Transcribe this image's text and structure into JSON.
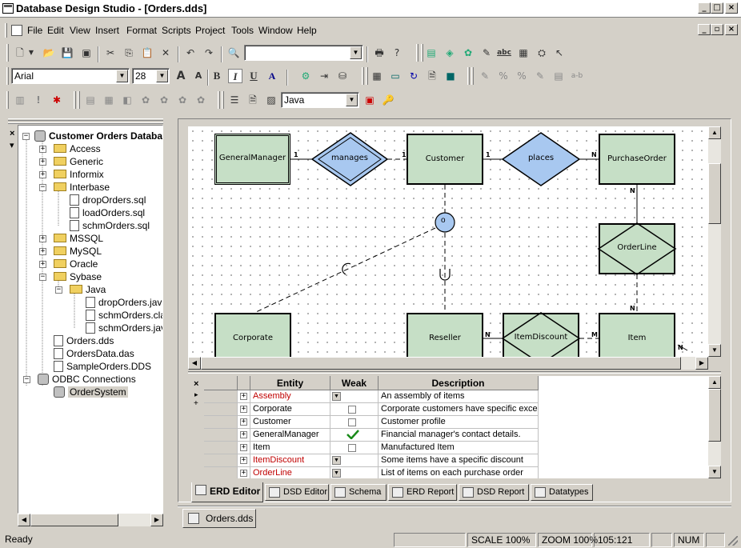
{
  "window": {
    "title": "Database Design Studio - [Orders.dds]",
    "min": "_",
    "max": "□",
    "close": "×",
    "restore": "▫"
  },
  "menu": [
    "File",
    "Edit",
    "View",
    "Insert",
    "Format",
    "Scripts",
    "Project",
    "Tools",
    "Window",
    "Help"
  ],
  "toolbar": {
    "font": "Arial",
    "size": "28",
    "bold": "B",
    "italic": "I",
    "underline": "U",
    "language": "Java",
    "abc": "abc",
    "ab": "a-b"
  },
  "tree": {
    "root": "Customer Orders Databa",
    "items": [
      {
        "label": "Access",
        "level": 1,
        "kind": "folder",
        "exp": "+"
      },
      {
        "label": "Generic",
        "level": 1,
        "kind": "folder",
        "exp": "+"
      },
      {
        "label": "Informix",
        "level": 1,
        "kind": "folder",
        "exp": "+"
      },
      {
        "label": "Interbase",
        "level": 1,
        "kind": "folder",
        "exp": "−"
      },
      {
        "label": "dropOrders.sql",
        "level": 2,
        "kind": "file"
      },
      {
        "label": "loadOrders.sql",
        "level": 2,
        "kind": "file"
      },
      {
        "label": "schmOrders.sql",
        "level": 2,
        "kind": "file"
      },
      {
        "label": "MSSQL",
        "level": 1,
        "kind": "folder",
        "exp": "+"
      },
      {
        "label": "MySQL",
        "level": 1,
        "kind": "folder",
        "exp": "+"
      },
      {
        "label": "Oracle",
        "level": 1,
        "kind": "folder",
        "exp": "+"
      },
      {
        "label": "Sybase",
        "level": 1,
        "kind": "folder",
        "exp": "−"
      },
      {
        "label": "Java",
        "level": 2,
        "kind": "folder",
        "exp": "−"
      },
      {
        "label": "dropOrders.java",
        "level": 3,
        "kind": "file"
      },
      {
        "label": "schmOrders.cla",
        "level": 3,
        "kind": "file"
      },
      {
        "label": "schmOrders.jav",
        "level": 3,
        "kind": "file"
      },
      {
        "label": "Orders.dds",
        "level": 1,
        "kind": "file"
      },
      {
        "label": "OrdersData.das",
        "level": 1,
        "kind": "file"
      },
      {
        "label": "SampleOrders.DDS",
        "level": 1,
        "kind": "file"
      },
      {
        "label": "ODBC Connections",
        "level": 0,
        "kind": "db",
        "exp": "−"
      },
      {
        "label": "OrderSystem",
        "level": 1,
        "kind": "db",
        "selected": true
      }
    ]
  },
  "diagram": {
    "entities": {
      "generalmanager": "GeneralManager",
      "customer": "Customer",
      "purchaseorder": "PurchaseOrder",
      "corporate": "Corporate",
      "reseller": "Reseller",
      "item": "Item"
    },
    "relationships": {
      "manages": "manages",
      "places": "places",
      "orderline": "OrderLine",
      "itemdiscount": "ItemDiscount"
    },
    "disjoint": "o",
    "cardinality": {
      "one": "1",
      "many": "N",
      "m": "M"
    }
  },
  "grid": {
    "headers": [
      "Entity",
      "Weak",
      "Description"
    ],
    "rows": [
      {
        "entity": "Assembly",
        "weak": "dropdown",
        "desc": "An assembly of items",
        "red": true
      },
      {
        "entity": "Corporate",
        "weak": "unchecked",
        "desc": "Corporate customers have specific exce",
        "red": false
      },
      {
        "entity": "Customer",
        "weak": "unchecked",
        "desc": "Customer profile",
        "red": false
      },
      {
        "entity": "GeneralManager",
        "weak": "checked",
        "desc": "Financial manager's contact details.",
        "red": false
      },
      {
        "entity": "Item",
        "weak": "unchecked",
        "desc": "Manufactured Item",
        "red": false
      },
      {
        "entity": "ItemDiscount",
        "weak": "dropdown",
        "desc": "Some items have a specific discount",
        "red": true
      },
      {
        "entity": "OrderLine",
        "weak": "dropdown",
        "desc": "List of items on each purchase order",
        "red": true
      }
    ],
    "side": [
      "×",
      "▸",
      "+"
    ]
  },
  "tabs": [
    "ERD Editor",
    "DSD Editor",
    "Schema",
    "ERD Report",
    "DSD Report",
    "Datatypes"
  ],
  "doc_tab": "Orders.dds",
  "status": {
    "ready": "Ready",
    "scale": "SCALE 100%",
    "zoom": "ZOOM 100%",
    "coords": "105:121",
    "num": "NUM"
  },
  "colors": {
    "entity": "#c6dfc6",
    "relationship": "#a8c8f0",
    "error_text": "#c00000"
  }
}
